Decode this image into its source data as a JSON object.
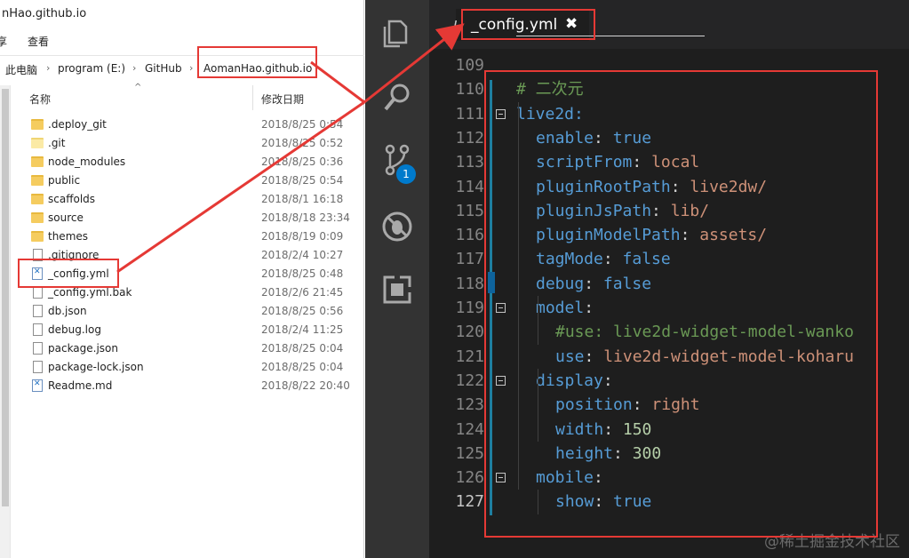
{
  "explorer": {
    "window_title": "nHao.github.io",
    "ribbon": {
      "left_cut": "享",
      "view": "查看"
    },
    "address": {
      "pc": "此电脑",
      "drive": "program (E:)",
      "github": "GitHub",
      "repo": "AomanHao.github.io"
    },
    "columns": {
      "name": "名称",
      "date": "修改日期"
    },
    "files": [
      {
        "name": ".deploy_git",
        "date": "2018/8/25 0:54",
        "icon": "folder-icon"
      },
      {
        "name": ".git",
        "date": "2018/8/25 0:52",
        "icon": "folder-light-icon"
      },
      {
        "name": "node_modules",
        "date": "2018/8/25 0:36",
        "icon": "folder-icon"
      },
      {
        "name": "public",
        "date": "2018/8/25 0:54",
        "icon": "folder-icon"
      },
      {
        "name": "scaffolds",
        "date": "2018/8/1 16:18",
        "icon": "folder-icon"
      },
      {
        "name": "source",
        "date": "2018/8/18 23:34",
        "icon": "folder-icon"
      },
      {
        "name": "themes",
        "date": "2018/8/19 0:09",
        "icon": "folder-icon"
      },
      {
        "name": ".gitignore",
        "date": "2018/2/4 10:27",
        "icon": "file-icon"
      },
      {
        "name": "_config.yml",
        "date": "2018/8/25 0:48",
        "icon": "vscode-file-icon"
      },
      {
        "name": "_config.yml.bak",
        "date": "2018/2/6 21:45",
        "icon": "file-icon"
      },
      {
        "name": "db.json",
        "date": "2018/8/25 0:56",
        "icon": "file-icon"
      },
      {
        "name": "debug.log",
        "date": "2018/2/4 11:25",
        "icon": "file-icon"
      },
      {
        "name": "package.json",
        "date": "2018/8/25 0:04",
        "icon": "file-icon"
      },
      {
        "name": "package-lock.json",
        "date": "2018/8/25 0:04",
        "icon": "file-icon"
      },
      {
        "name": "Readme.md",
        "date": "2018/8/22 20:40",
        "icon": "vscode-file-icon"
      }
    ]
  },
  "editor": {
    "tab": {
      "prefix": "I",
      "label": "_config.yml",
      "close": "✖"
    },
    "scm_badge": "1",
    "activity_icons": [
      "files-icon",
      "search-icon",
      "source-control-icon",
      "debug-icon",
      "extensions-icon"
    ],
    "lines": [
      {
        "num": "109",
        "code": ""
      },
      {
        "num": "110",
        "code": "# 二次元"
      },
      {
        "num": "111",
        "code": "live2d:"
      },
      {
        "num": "112",
        "key": "enable",
        "val": "true"
      },
      {
        "num": "113",
        "key": "scriptFrom",
        "val": "local"
      },
      {
        "num": "114",
        "key": "pluginRootPath",
        "val": "live2dw/"
      },
      {
        "num": "115",
        "key": "pluginJsPath",
        "val": "lib/"
      },
      {
        "num": "116",
        "key": "pluginModelPath",
        "val": "assets/"
      },
      {
        "num": "117",
        "key": "tagMode",
        "val": "false"
      },
      {
        "num": "118",
        "key": "debug",
        "val": "false"
      },
      {
        "num": "119",
        "key": "model",
        "val": ""
      },
      {
        "num": "120",
        "code": "#use: live2d-widget-model-wanko"
      },
      {
        "num": "121",
        "key": "use",
        "val": "live2d-widget-model-koharu"
      },
      {
        "num": "122",
        "key": "display",
        "val": ""
      },
      {
        "num": "123",
        "key": "position",
        "val": "right"
      },
      {
        "num": "124",
        "key": "width",
        "val": "150"
      },
      {
        "num": "125",
        "key": "height",
        "val": "300"
      },
      {
        "num": "126",
        "key": "mobile",
        "val": ""
      },
      {
        "num": "127",
        "key": "show",
        "val": "true"
      }
    ]
  },
  "watermark": "@稀土掘金技术社区",
  "colors": {
    "annotation": "#e53935",
    "editor_bg": "#1e1e1e",
    "activity_bg": "#333333",
    "keyword": "#569cd6",
    "string": "#ce9178",
    "number": "#b5cea8",
    "comment": "#6a9955"
  }
}
